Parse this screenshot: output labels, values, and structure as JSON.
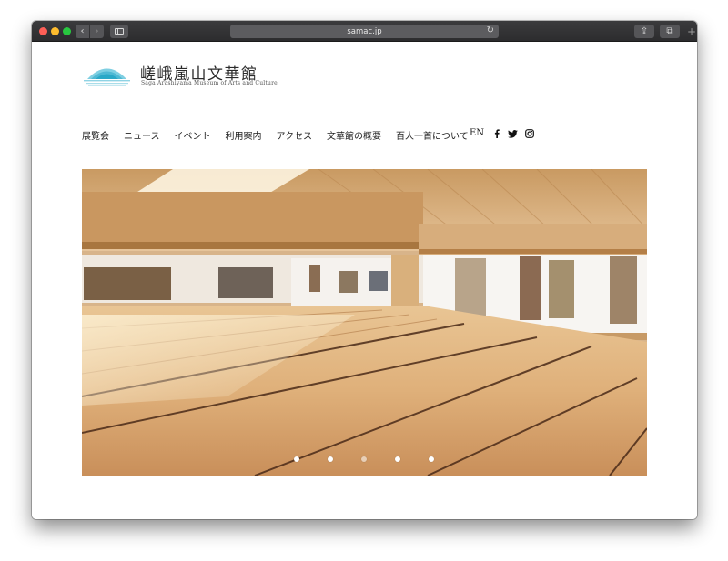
{
  "browser": {
    "url": "samac.jp",
    "back_glyph": "‹",
    "forward_glyph": "›",
    "reload_glyph": "↻",
    "share_glyph": "⇪",
    "tabs_glyph": "⧉",
    "new_tab_glyph": "+"
  },
  "site": {
    "title": "嵯峨嵐山文華館",
    "subtitle": "Saga Arashiyama Museum of Arts and Culture",
    "logo_colors": [
      "#9ad7e6",
      "#6cc3d9",
      "#2aa8c7"
    ]
  },
  "nav": {
    "items": [
      "展覧会",
      "ニュース",
      "イベント",
      "利用案内",
      "アクセス",
      "文華館の概要",
      "百人一首について"
    ],
    "lang": "EN",
    "social_icons": [
      "facebook-icon",
      "twitter-icon",
      "instagram-icon"
    ]
  },
  "hero": {
    "slides": 5,
    "active_slide": 3
  }
}
